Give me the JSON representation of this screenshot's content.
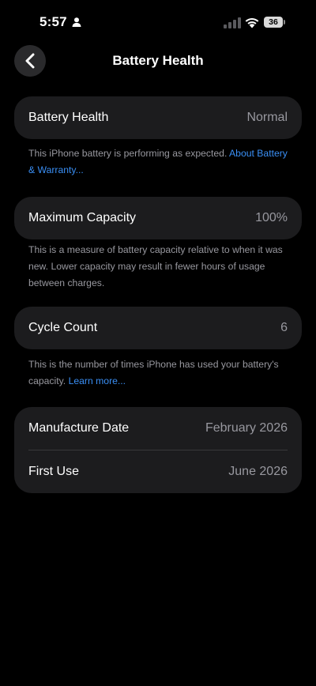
{
  "status_bar": {
    "time": "5:57",
    "battery_level": "36"
  },
  "nav": {
    "title": "Battery Health"
  },
  "battery_health": {
    "label": "Battery Health",
    "value": "Normal",
    "note": "This iPhone battery is performing as expected. ",
    "note_link": "About Battery & Warranty..."
  },
  "maximum_capacity": {
    "label": "Maximum Capacity",
    "value": "100%",
    "note": "This is a measure of battery capacity relative to when it was new. Lower capacity may result in fewer hours of usage between charges."
  },
  "cycle_count": {
    "label": "Cycle Count",
    "value": "6",
    "note": "This is the number of times iPhone has used your battery's capacity. ",
    "note_link": "Learn more..."
  },
  "dates": {
    "manufacture_label": "Manufacture Date",
    "manufacture_value": "February 2026",
    "first_use_label": "First Use",
    "first_use_value": "June 2026"
  },
  "colors": {
    "background": "#000000",
    "card": "#1c1c1e",
    "secondary_text": "#98989f",
    "link": "#3a8ff5"
  }
}
